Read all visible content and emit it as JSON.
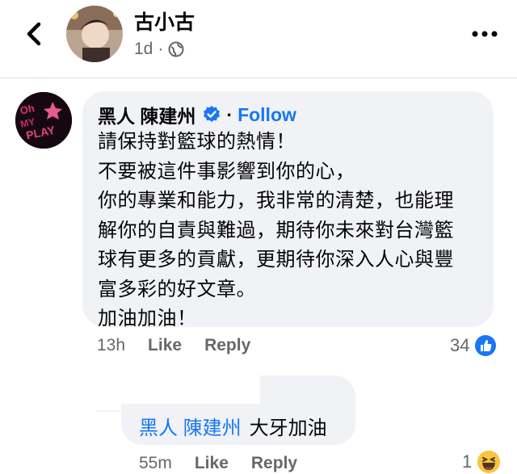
{
  "post": {
    "author": "古小古",
    "time": "1d",
    "time_separator": "·"
  },
  "comment1": {
    "author": "黑人 陳建州",
    "separator": "·",
    "follow_label": "Follow",
    "text": "請保持對籃球的熱情！\n不要被這件事影響到你的心，\n你的專業和能力，我非常的清楚，也能理\n解你的自責與難過，期待你未來對台灣籃\n球有更多的貢獻，更期待你深入人心與豐\n富多彩的好文章。\n加油加油！",
    "time": "13h",
    "like_label": "Like",
    "reply_label": "Reply",
    "reaction_count": "34"
  },
  "comment2": {
    "mention": "黑人 陳建州",
    "text": "大牙加油",
    "time": "55m",
    "like_label": "Like",
    "reply_label": "Reply",
    "reaction_count": "1"
  },
  "colors": {
    "accent": "#1877f2",
    "bubble": "#f0f2f5",
    "muted": "#65676b"
  }
}
